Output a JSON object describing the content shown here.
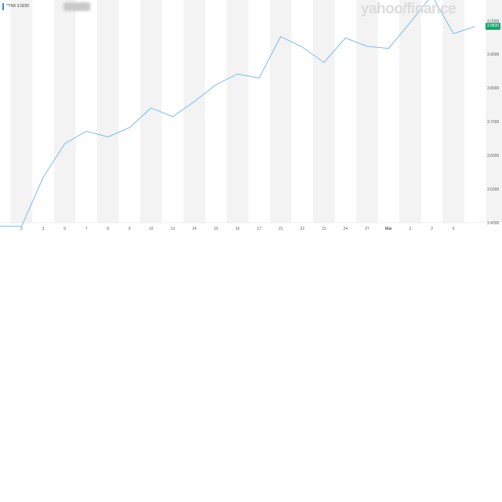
{
  "legend": {
    "symbol": "^TNX",
    "value": "3.9220"
  },
  "watermark": "yahoo/finance",
  "current_price_label": "3.9830",
  "colors": {
    "line": "#6db6ea",
    "band": "#f3f3f3",
    "price_tag": "#0fa86f",
    "legend_bar": "#1e90ff"
  },
  "chart_data": {
    "type": "line",
    "title": "",
    "xlabel": "",
    "ylabel": "",
    "x_ticks": [
      "2",
      "3",
      "6",
      "7",
      "8",
      "9",
      "10",
      "13",
      "14",
      "15",
      "16",
      "17",
      "21",
      "22",
      "23",
      "24",
      "27",
      "Mar",
      "2",
      "3",
      "6"
    ],
    "major_tick_labels": [
      "Mar"
    ],
    "y_ticks": [
      "4.0000",
      "3.9000",
      "3.8000",
      "3.7000",
      "3.6000",
      "3.5000",
      "3.4000"
    ],
    "ylim": [
      3.4,
      4.05
    ],
    "series": [
      {
        "x": [
          "Feb 1",
          "Feb 2",
          "Feb 3",
          "Feb 6",
          "Feb 7",
          "Feb 8",
          "Feb 9",
          "Feb 10",
          "Feb 13",
          "Feb 14",
          "Feb 15",
          "Feb 16",
          "Feb 17",
          "Feb 21",
          "Feb 22",
          "Feb 23",
          "Feb 24",
          "Feb 27",
          "Feb 28",
          "Mar 1",
          "Mar 2",
          "Mar 3",
          "Mar 6"
        ],
        "values": [
          3.39,
          3.39,
          3.535,
          3.635,
          3.672,
          3.655,
          3.683,
          3.741,
          3.715,
          3.76,
          3.81,
          3.842,
          3.83,
          3.953,
          3.922,
          3.876,
          3.949,
          3.924,
          3.918,
          3.995,
          4.075,
          3.962,
          3.983
        ]
      }
    ],
    "grid": false,
    "alternating_bands": true
  }
}
